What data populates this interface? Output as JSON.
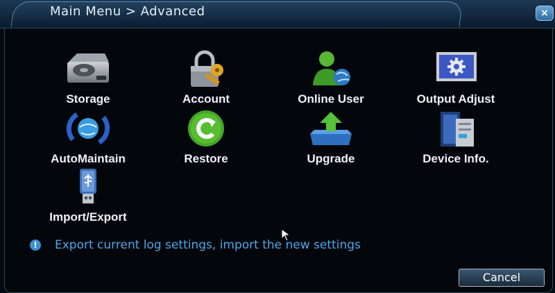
{
  "window": {
    "title": "Main Menu > Advanced",
    "close_icon": "×"
  },
  "menu_items": [
    {
      "label": "Storage",
      "icon": "hard-drive-icon"
    },
    {
      "label": "Account",
      "icon": "padlock-key-icon"
    },
    {
      "label": "Online User",
      "icon": "online-user-icon"
    },
    {
      "label": "Output Adjust",
      "icon": "monitor-gear-icon"
    },
    {
      "label": "AutoMaintain",
      "icon": "globe-arrows-icon"
    },
    {
      "label": "Restore",
      "icon": "restore-icon"
    },
    {
      "label": "Upgrade",
      "icon": "upgrade-icon"
    },
    {
      "label": "Device Info.",
      "icon": "device-info-icon"
    },
    {
      "label": "Import/Export",
      "icon": "usb-drive-icon"
    }
  ],
  "info": {
    "icon": "!",
    "text": "Export current log settings, import the new settings"
  },
  "buttons": {
    "cancel": "Cancel"
  },
  "colors": {
    "accent": "#4fa6e8",
    "background": "#03070c"
  }
}
